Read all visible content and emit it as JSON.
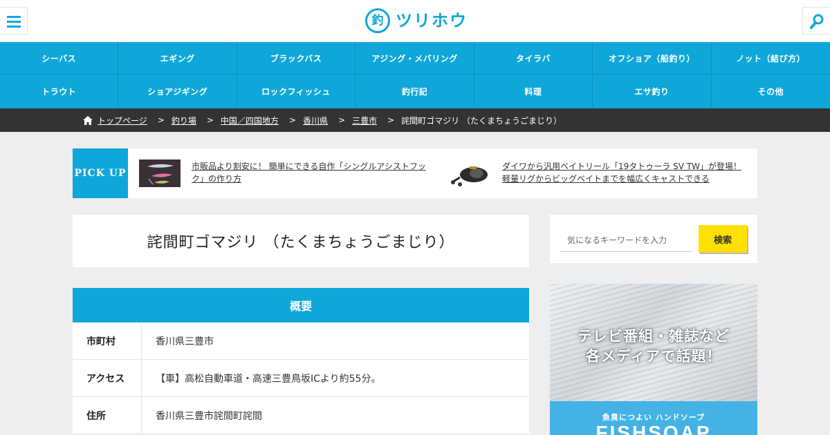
{
  "header": {
    "logo_mark": "釣",
    "logo_text": "ツリホウ"
  },
  "nav": {
    "row1": [
      "シーバス",
      "エギング",
      "ブラックバス",
      "アジング・メバリング",
      "タイラバ",
      "オフショア（船釣り）",
      "ノット（結び方）"
    ],
    "row2": [
      "トラウト",
      "ショアジギング",
      "ロックフィッシュ",
      "釣行記",
      "料理",
      "エサ釣り",
      "その他"
    ]
  },
  "breadcrumb": {
    "items": [
      "トップページ",
      "釣り場",
      "中国／四国地方",
      "香川県",
      "三豊市"
    ],
    "separator": ">",
    "current": "詫間町ゴマジリ （たくまちょうごまじり）"
  },
  "pickup": {
    "label": "PICK UP",
    "articles": [
      {
        "title": "市販品より割安に！ 簡単にできる自作「シングルアシストフック」の作り方"
      },
      {
        "title": "ダイワから汎用ベイトリール「19タトゥーラ SV TW」が登場！軽量リグからビッグベイトまでを幅広くキャストできる"
      }
    ]
  },
  "page": {
    "title": "詫間町ゴマジリ （たくまちょうごまじり）"
  },
  "overview": {
    "heading": "概要",
    "rows": [
      {
        "key": "市町村",
        "value": "香川県三豊市"
      },
      {
        "key": "アクセス",
        "value": "【車】高松自動車道・高速三豊鳥坂ICより約55分。"
      },
      {
        "key": "住所",
        "value": "香川県三豊市詫間町詫間"
      }
    ]
  },
  "sidebar": {
    "search_placeholder": "気になるキーワードを入力",
    "search_button": "検索",
    "ad_headline_line1": "テレビ番組・雑誌など",
    "ad_headline_line2": "各メディアで話題！",
    "ad_sub": "魚臭につよい ハンドソープ",
    "ad_brand": "FISHSOAP"
  },
  "colors": {
    "brand_blue": "#0fa7d9",
    "breadcrumb_bg": "#333333",
    "search_button": "#ffe000",
    "page_bg": "#eeeeee"
  }
}
